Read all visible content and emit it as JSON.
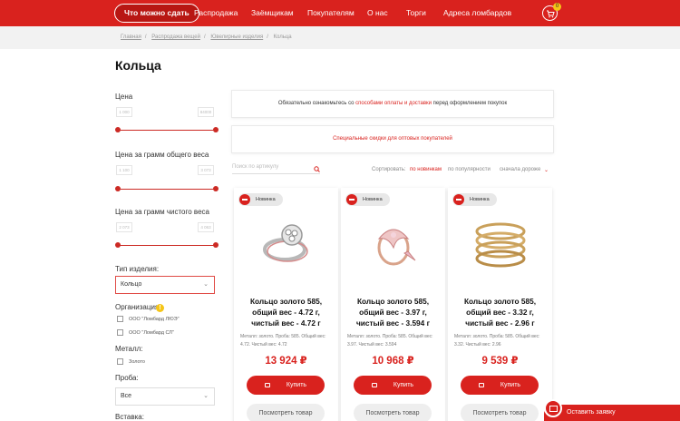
{
  "nav": {
    "items": [
      "Что можно сдать",
      "Распродажа",
      "Заёмщикам",
      "Покупателям",
      "О нас",
      "Торги",
      "Адреса ломбардов"
    ],
    "cart_count": "0"
  },
  "breadcrumb": [
    "Главная",
    "Распродажа вещей",
    "Ювелирные изделия",
    "Кольца"
  ],
  "page_title": "Кольца",
  "filters": {
    "price_label": "Цена",
    "price_from": "1 000",
    "price_to": "84000",
    "gross_label": "Цена за грамм общего веса",
    "gross_from": "1 100",
    "gross_to": "3 073",
    "net_label": "Цена за грамм чистого веса",
    "net_from": "2 073",
    "net_to": "4 063",
    "type_label": "Тип изделия:",
    "type_value": "Кольцо",
    "org_label": "Организация:",
    "org_options": [
      "ООО \"Ломбард ЛЮЭ\"",
      "ООО \"Ломбард СЛ\""
    ],
    "metal_label": "Металл:",
    "metal_option": "Золото",
    "probe_label": "Проба:",
    "probe_value": "Все",
    "insert_label": "Вставка:"
  },
  "info": {
    "notice_before": "Обязательно ознакомьтесь со ",
    "notice_link": "способами оплаты и доставки",
    "notice_after": " перед оформлением покупок",
    "discount": "Специальные скидки для оптовых покупателей"
  },
  "sort": {
    "search_placeholder": "Поиск по артикулу",
    "label": "Сортировать:",
    "options": [
      "по новинкам",
      "по популярности",
      "сначала дороже"
    ],
    "active": "по новинкам"
  },
  "products": [
    {
      "badge": "Новинка",
      "title": "Кольцо золото 585, общий вес - 4.72 г, чистый вес - 4.72 г",
      "desc": "Металл: золото. Проба: 585. Общий вес: 4.72. Чистый вес: 4.72",
      "price": "13 924 ₽",
      "buy": "Купить",
      "view": "Посмотреть товар"
    },
    {
      "badge": "Новинка",
      "title": "Кольцо золото 585, общий вес - 3.97 г, чистый вес - 3.594 г",
      "desc": "Металл: золото. Проба: 585. Общий вес: 3.97. Чистый вес: 3.594",
      "price": "10 968 ₽",
      "buy": "Купить",
      "view": "Посмотреть товар"
    },
    {
      "badge": "Новинка",
      "title": "Кольцо золото 585, общий вес - 3.32 г, чистый вес - 2.96 г",
      "desc": "Металл: золото. Проба: 585. Общий вес: 3.32. Чистый вес: 2.96",
      "price": "9 539 ₽",
      "buy": "Купить",
      "view": "Посмотреть товар"
    }
  ],
  "request_button": "Оставить заявку",
  "colors": {
    "brand_red": "#d9221e",
    "badge_yellow": "#f5c518"
  }
}
